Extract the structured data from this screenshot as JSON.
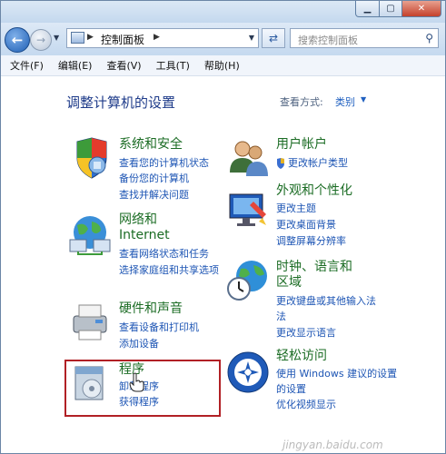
{
  "address": {
    "current_location": "控制面板",
    "search_placeholder": "搜索控制面板"
  },
  "menu": [
    "文件(F)",
    "编辑(E)",
    "查看(V)",
    "工具(T)",
    "帮助(H)"
  ],
  "page": {
    "title": "调整计算机的设置",
    "view_by_label": "查看方式:",
    "view_by_value": "类别"
  },
  "left_categories": [
    {
      "title": "系统和安全",
      "icon": "shield-icon",
      "tasks": [
        "查看您的计算机状态",
        "备份您的计算机",
        "查找并解决问题"
      ]
    },
    {
      "title": "网络和 Internet",
      "icon": "network-icon",
      "tasks": [
        "查看网络状态和任务",
        "选择家庭组和共享选项"
      ]
    },
    {
      "title": "硬件和声音",
      "icon": "printer-icon",
      "tasks": [
        "查看设备和打印机",
        "添加设备"
      ]
    },
    {
      "title": "程序",
      "icon": "programs-icon",
      "tasks": [
        "卸载程序",
        "获得程序"
      ]
    }
  ],
  "right_categories": [
    {
      "title": "用户帐户",
      "icon": "users-icon",
      "tasks": [
        "更改帐户类型"
      ]
    },
    {
      "title": "外观和个性化",
      "icon": "appearance-icon",
      "tasks": [
        "更改主题",
        "更改桌面背景",
        "调整屏幕分辨率"
      ]
    },
    {
      "title": "时钟、语言和区域",
      "icon": "clock-globe-icon",
      "tasks": [
        "更改键盘或其他输入法",
        "更改显示语言"
      ]
    },
    {
      "title": "轻松访问",
      "icon": "ease-of-access-icon",
      "tasks": [
        "使用 Windows 建议的设置",
        "优化视频显示"
      ]
    }
  ],
  "watermark": "jingyan.baidu.com",
  "colors": {
    "link": "#1d55b4",
    "category_title": "#1b6c24",
    "page_title": "#1e3b8a",
    "highlight_box": "#b12025"
  }
}
